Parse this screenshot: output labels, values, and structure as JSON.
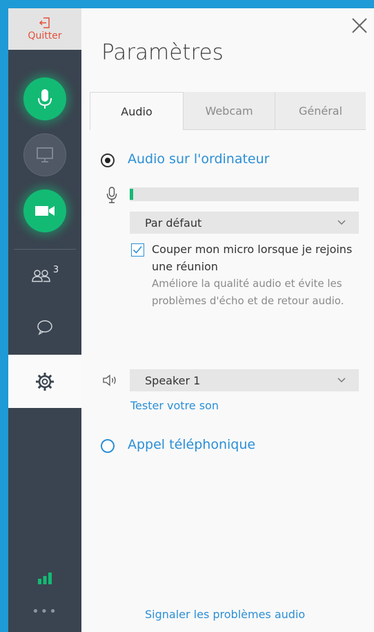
{
  "sidebar": {
    "quit_label": "Quitter",
    "participants_count": "3",
    "icons": [
      "microphone-icon",
      "screen-share-icon",
      "camera-icon",
      "participants-icon",
      "chat-icon",
      "gear-icon",
      "signal-icon",
      "more-icon"
    ]
  },
  "panel": {
    "title": "Paramètres",
    "tabs": [
      {
        "label": "Audio",
        "active": true
      },
      {
        "label": "Webcam",
        "active": false
      },
      {
        "label": "Général",
        "active": false
      }
    ],
    "computer_audio": {
      "label": "Audio sur l'ordinateur",
      "selected": true,
      "mic_level_fraction": 0.015,
      "mic_device": "Par défaut",
      "mute_checkbox": {
        "checked": true,
        "label": "Couper mon micro lorsque je rejoins une réunion",
        "description": "Améliore la qualité audio et évite les problèmes d'écho et de retour audio."
      },
      "speaker_device": "Speaker 1",
      "test_sound_link": "Tester votre son"
    },
    "phone_call": {
      "label": "Appel téléphonique",
      "selected": false
    },
    "report_link": "Signaler les problèmes audio"
  },
  "colors": {
    "accent_blue": "#2b8fd6",
    "green": "#13ba74",
    "quit_red": "#e4513b",
    "sidebar": "#3a4450"
  }
}
